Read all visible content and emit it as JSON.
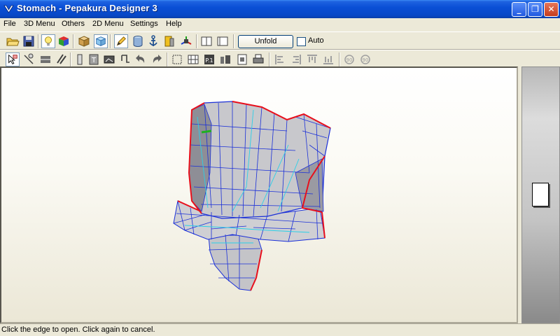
{
  "window": {
    "title": "Stomach - Pepakura Designer 3",
    "buttons": {
      "minimize": "_",
      "maximize": "❐",
      "close": "✕"
    }
  },
  "menu": {
    "items": [
      "File",
      "3D Menu",
      "Others",
      "2D Menu",
      "Settings",
      "Help"
    ]
  },
  "toolbar": {
    "unfold_label": "Unfold",
    "auto_label": "Auto",
    "auto_checked": false,
    "icons_row1": [
      "open-folder-icon",
      "save-icon",
      "lightbulb-icon",
      "texture-cube-icon",
      "solid-cube-icon",
      "wireframe-cube-icon",
      "pencil-icon",
      "cylinder-icon",
      "anchor-icon",
      "fold-edges-icon",
      "axis-icon",
      "single-view-icon",
      "split-view-icon"
    ],
    "icons_row2": [
      "select-arrow-icon",
      "join-edge-icon",
      "flap-icon",
      "rotate-part-icon",
      "edge-id-icon",
      "text-icon",
      "image-icon",
      "move-icon",
      "undo-icon",
      "redo-icon",
      "align-icon",
      "grid-icon",
      "page-number-icon",
      "arrange-icon",
      "fit-page-icon",
      "print-icon",
      "align-left-icon",
      "align-center-icon",
      "align-top-icon",
      "align-bottom-icon",
      "rotate-90-icon",
      "rotate-minus-90-icon"
    ]
  },
  "view": {
    "background_top": "#ffffff",
    "background_bottom": "#ebe7d6",
    "mesh_fill": "#c8c8cc",
    "mesh_edge": "#1a2fd8",
    "cut_edge": "#e8101c",
    "fold_edge": "#2ad0e8"
  },
  "status": {
    "text": "Click the edge to open. Click again to cancel."
  }
}
